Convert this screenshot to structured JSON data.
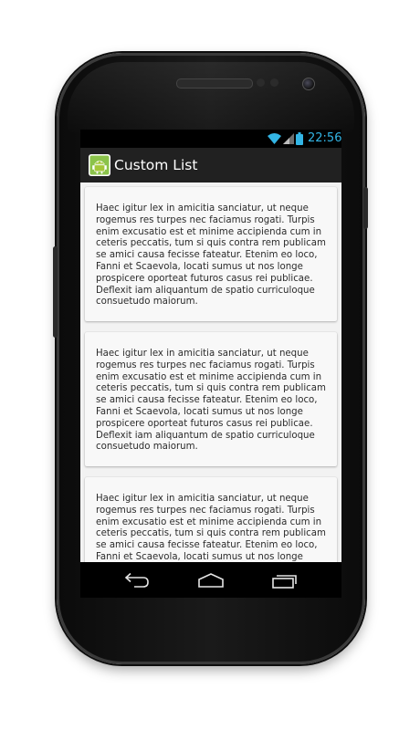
{
  "status_bar": {
    "time": "22:56",
    "icons": [
      "wifi-icon",
      "signal-icon",
      "battery-icon"
    ],
    "accent_color": "#33b5e5"
  },
  "action_bar": {
    "app_icon": "android-robot-icon",
    "title": "Custom List"
  },
  "list": {
    "items": [
      {
        "text": "Haec igitur lex in amicitia sanciatur, ut neque rogemus res turpes nec faciamus rogati. Turpis enim excusatio est et minime accipienda cum in ceteris peccatis, tum si quis contra rem publicam se amici causa fecisse fateatur. Etenim eo loco, Fanni et Scaevola, locati sumus ut nos longe prospicere oporteat futuros casus rei publicae. Deflexit iam aliquantum de spatio curriculoque consuetudo maiorum."
      },
      {
        "text": "Haec igitur lex in amicitia sanciatur, ut neque rogemus res turpes nec faciamus rogati. Turpis enim excusatio est et minime accipienda cum in ceteris peccatis, tum si quis contra rem publicam se amici causa fecisse fateatur. Etenim eo loco, Fanni et Scaevola, locati sumus ut nos longe prospicere oporteat futuros casus rei publicae. Deflexit iam aliquantum de spatio curriculoque consuetudo maiorum."
      },
      {
        "text": "Haec igitur lex in amicitia sanciatur, ut neque rogemus res turpes nec faciamus rogati. Turpis enim excusatio est et minime accipienda cum in ceteris peccatis, tum si quis contra rem publicam se amici causa fecisse fateatur. Etenim eo loco, Fanni et Scaevola, locati sumus ut nos longe"
      }
    ]
  },
  "nav_bar": {
    "buttons": [
      "back-icon",
      "home-icon",
      "recent-apps-icon"
    ]
  }
}
